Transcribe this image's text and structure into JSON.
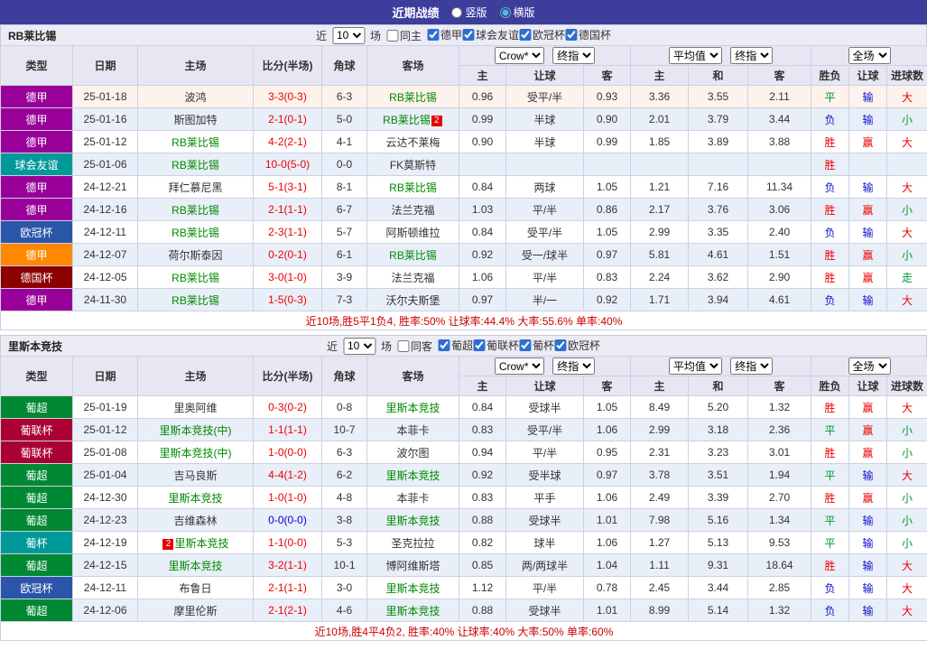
{
  "topbar": {
    "title": "近期战绩",
    "vertical": "竖版",
    "horizontal": "横版",
    "selected": "横版"
  },
  "result_colors": {
    "胜": "#ee0000",
    "平": "#009933",
    "负": "#1111cc",
    "赢": "#ee0000",
    "输": "#1111cc",
    "大": "#ee0000",
    "小": "#009933",
    "走": "#009933"
  },
  "sections": [
    {
      "team": "RB莱比锡",
      "filter": {
        "near": "近",
        "count": "10",
        "games": "场",
        "same": "同主",
        "same_checked": false,
        "leagues": [
          "德甲",
          "球会友谊",
          "欧冠杯",
          "德国杯"
        ]
      },
      "header": {
        "type": "类型",
        "date": "日期",
        "home": "主场",
        "score": "比分(半场)",
        "corner": "角球",
        "away": "客场",
        "dd1": "Crow*",
        "dd2": "终指",
        "dd3": "平均值",
        "dd4": "终指",
        "dd5": "全场",
        "sub": [
          "主",
          "让球",
          "客",
          "主",
          "和",
          "客",
          "胜负",
          "让球",
          "进球数"
        ]
      },
      "rows": [
        {
          "league": "德甲",
          "league_color": "#990099",
          "date": "25-01-18",
          "home": "波鸿",
          "home_green": false,
          "score": "3-3(0-3)",
          "score_color": "#ee0000",
          "corners": "6-3",
          "away": "RB莱比锡",
          "away_green": true,
          "asian_home": "0.96",
          "handicap": "受平/半",
          "asian_away": "0.93",
          "euro_home": "3.36",
          "euro_draw": "3.55",
          "euro_away": "2.11",
          "result": "平",
          "handicap_result": "输",
          "goals_result": "大",
          "highlight": true
        },
        {
          "league": "德甲",
          "league_color": "#990099",
          "date": "25-01-16",
          "home": "斯图加特",
          "home_green": false,
          "score": "2-1(0-1)",
          "score_color": "#ee0000",
          "corners": "5-0",
          "away": "RB莱比锡",
          "away_green": true,
          "away_card": "2",
          "away_card_pos": "after",
          "asian_home": "0.99",
          "handicap": "半球",
          "asian_away": "0.90",
          "euro_home": "2.01",
          "euro_draw": "3.79",
          "euro_away": "3.44",
          "result": "负",
          "handicap_result": "输",
          "goals_result": "小"
        },
        {
          "league": "德甲",
          "league_color": "#990099",
          "date": "25-01-12",
          "home": "RB莱比锡",
          "home_green": true,
          "score": "4-2(2-1)",
          "score_color": "#ee0000",
          "corners": "4-1",
          "away": "云达不莱梅",
          "away_green": false,
          "asian_home": "0.90",
          "handicap": "半球",
          "asian_away": "0.99",
          "euro_home": "1.85",
          "euro_draw": "3.89",
          "euro_away": "3.88",
          "result": "胜",
          "handicap_result": "赢",
          "goals_result": "大"
        },
        {
          "league": "球会友谊",
          "league_color": "#009999",
          "date": "25-01-06",
          "home": "RB莱比锡",
          "home_green": true,
          "score": "10-0(5-0)",
          "score_color": "#ee0000",
          "corners": "0-0",
          "away": "FK莫斯特",
          "away_green": false,
          "asian_home": "",
          "handicap": "",
          "asian_away": "",
          "euro_home": "",
          "euro_draw": "",
          "euro_away": "",
          "result": "胜",
          "handicap_result": "",
          "goals_result": ""
        },
        {
          "league": "德甲",
          "league_color": "#990099",
          "date": "24-12-21",
          "home": "拜仁慕尼黑",
          "home_green": false,
          "score": "5-1(3-1)",
          "score_color": "#ee0000",
          "corners": "8-1",
          "away": "RB莱比锡",
          "away_green": true,
          "asian_home": "0.84",
          "handicap": "两球",
          "asian_away": "1.05",
          "euro_home": "1.21",
          "euro_draw": "7.16",
          "euro_away": "11.34",
          "result": "负",
          "handicap_result": "输",
          "goals_result": "大"
        },
        {
          "league": "德甲",
          "league_color": "#990099",
          "date": "24-12-16",
          "home": "RB莱比锡",
          "home_green": true,
          "score": "2-1(1-1)",
          "score_color": "#ee0000",
          "corners": "6-7",
          "away": "法兰克福",
          "away_green": false,
          "asian_home": "1.03",
          "handicap": "平/半",
          "asian_away": "0.86",
          "euro_home": "2.17",
          "euro_draw": "3.76",
          "euro_away": "3.06",
          "result": "胜",
          "handicap_result": "赢",
          "goals_result": "小"
        },
        {
          "league": "欧冠杯",
          "league_color": "#2b55a8",
          "date": "24-12-11",
          "home": "RB莱比锡",
          "home_green": true,
          "score": "2-3(1-1)",
          "score_color": "#ee0000",
          "corners": "5-7",
          "away": "阿斯顿维拉",
          "away_green": false,
          "asian_home": "0.84",
          "handicap": "受平/半",
          "asian_away": "1.05",
          "euro_home": "2.99",
          "euro_draw": "3.35",
          "euro_away": "2.40",
          "result": "负",
          "handicap_result": "输",
          "goals_result": "大"
        },
        {
          "league": "德甲",
          "league_color": "#ff8800",
          "date": "24-12-07",
          "home": "荷尔斯泰因",
          "home_green": false,
          "score": "0-2(0-1)",
          "score_color": "#ee0000",
          "corners": "6-1",
          "away": "RB莱比锡",
          "away_green": true,
          "asian_home": "0.92",
          "handicap": "受一/球半",
          "asian_away": "0.97",
          "euro_home": "5.81",
          "euro_draw": "4.61",
          "euro_away": "1.51",
          "result": "胜",
          "handicap_result": "赢",
          "goals_result": "小"
        },
        {
          "league": "德国杯",
          "league_color": "#8b0000",
          "date": "24-12-05",
          "home": "RB莱比锡",
          "home_green": true,
          "score": "3-0(1-0)",
          "score_color": "#ee0000",
          "corners": "3-9",
          "away": "法兰克福",
          "away_green": false,
          "asian_home": "1.06",
          "handicap": "平/半",
          "asian_away": "0.83",
          "euro_home": "2.24",
          "euro_draw": "3.62",
          "euro_away": "2.90",
          "result": "胜",
          "handicap_result": "赢",
          "goals_result": "走"
        },
        {
          "league": "德甲",
          "league_color": "#990099",
          "date": "24-11-30",
          "home": "RB莱比锡",
          "home_green": true,
          "score": "1-5(0-3)",
          "score_color": "#ee0000",
          "corners": "7-3",
          "away": "沃尔夫斯堡",
          "away_green": false,
          "asian_home": "0.97",
          "handicap": "半/一",
          "asian_away": "0.92",
          "euro_home": "1.71",
          "euro_draw": "3.94",
          "euro_away": "4.61",
          "result": "负",
          "handicap_result": "输",
          "goals_result": "大"
        }
      ],
      "footer": "近10场,胜5平1负4, 胜率:50% 让球率:44.4% 大率:55.6% 单率:40%"
    },
    {
      "team": "里斯本竞技",
      "filter": {
        "near": "近",
        "count": "10",
        "games": "场",
        "same": "同客",
        "same_checked": false,
        "leagues": [
          "葡超",
          "葡联杯",
          "葡杯",
          "欧冠杯"
        ]
      },
      "header": {
        "type": "类型",
        "date": "日期",
        "home": "主场",
        "score": "比分(半场)",
        "corner": "角球",
        "away": "客场",
        "dd1": "Crow*",
        "dd2": "终指",
        "dd3": "平均值",
        "dd4": "终指",
        "dd5": "全场",
        "sub": [
          "主",
          "让球",
          "客",
          "主",
          "和",
          "客",
          "胜负",
          "让球",
          "进球数"
        ]
      },
      "rows": [
        {
          "league": "葡超",
          "league_color": "#008833",
          "date": "25-01-19",
          "home": "里奥阿维",
          "home_green": false,
          "score": "0-3(0-2)",
          "score_color": "#ee0000",
          "corners": "0-8",
          "away": "里斯本竞技",
          "away_green": true,
          "asian_home": "0.84",
          "handicap": "受球半",
          "asian_away": "1.05",
          "euro_home": "8.49",
          "euro_draw": "5.20",
          "euro_away": "1.32",
          "result": "胜",
          "handicap_result": "赢",
          "goals_result": "大"
        },
        {
          "league": "葡联杯",
          "league_color": "#aa0033",
          "date": "25-01-12",
          "home": "里斯本竞技(中)",
          "home_green": true,
          "score": "1-1(1-1)",
          "score_color": "#ee0000",
          "corners": "10-7",
          "away": "本菲卡",
          "away_green": false,
          "asian_home": "0.83",
          "handicap": "受平/半",
          "asian_away": "1.06",
          "euro_home": "2.99",
          "euro_draw": "3.18",
          "euro_away": "2.36",
          "result": "平",
          "handicap_result": "赢",
          "goals_result": "小"
        },
        {
          "league": "葡联杯",
          "league_color": "#aa0033",
          "date": "25-01-08",
          "home": "里斯本竞技(中)",
          "home_green": true,
          "score": "1-0(0-0)",
          "score_color": "#ee0000",
          "corners": "6-3",
          "away": "波尔图",
          "away_green": false,
          "asian_home": "0.94",
          "handicap": "平/半",
          "asian_away": "0.95",
          "euro_home": "2.31",
          "euro_draw": "3.23",
          "euro_away": "3.01",
          "result": "胜",
          "handicap_result": "赢",
          "goals_result": "小"
        },
        {
          "league": "葡超",
          "league_color": "#008833",
          "date": "25-01-04",
          "home": "吉马良斯",
          "home_green": false,
          "score": "4-4(1-2)",
          "score_color": "#ee0000",
          "corners": "6-2",
          "away": "里斯本竞技",
          "away_green": true,
          "asian_home": "0.92",
          "handicap": "受半球",
          "asian_away": "0.97",
          "euro_home": "3.78",
          "euro_draw": "3.51",
          "euro_away": "1.94",
          "result": "平",
          "handicap_result": "输",
          "goals_result": "大"
        },
        {
          "league": "葡超",
          "league_color": "#008833",
          "date": "24-12-30",
          "home": "里斯本竞技",
          "home_green": true,
          "score": "1-0(1-0)",
          "score_color": "#ee0000",
          "corners": "4-8",
          "away": "本菲卡",
          "away_green": false,
          "asian_home": "0.83",
          "handicap": "平手",
          "asian_away": "1.06",
          "euro_home": "2.49",
          "euro_draw": "3.39",
          "euro_away": "2.70",
          "result": "胜",
          "handicap_result": "赢",
          "goals_result": "小"
        },
        {
          "league": "葡超",
          "league_color": "#008833",
          "date": "24-12-23",
          "home": "吉维森林",
          "home_green": false,
          "score": "0-0(0-0)",
          "score_color": "#0000dd",
          "corners": "3-8",
          "away": "里斯本竞技",
          "away_green": true,
          "asian_home": "0.88",
          "handicap": "受球半",
          "asian_away": "1.01",
          "euro_home": "7.98",
          "euro_draw": "5.16",
          "euro_away": "1.34",
          "result": "平",
          "handicap_result": "输",
          "goals_result": "小"
        },
        {
          "league": "葡杯",
          "league_color": "#009999",
          "date": "24-12-19",
          "home": "里斯本竞技",
          "home_green": true,
          "home_card": "2",
          "home_card_pos": "before",
          "score": "1-1(0-0)",
          "score_color": "#ee0000",
          "corners": "5-3",
          "away": "圣克拉拉",
          "away_green": false,
          "asian_home": "0.82",
          "handicap": "球半",
          "asian_away": "1.06",
          "euro_home": "1.27",
          "euro_draw": "5.13",
          "euro_away": "9.53",
          "result": "平",
          "handicap_result": "输",
          "goals_result": "小"
        },
        {
          "league": "葡超",
          "league_color": "#008833",
          "date": "24-12-15",
          "home": "里斯本竞技",
          "home_green": true,
          "score": "3-2(1-1)",
          "score_color": "#ee0000",
          "corners": "10-1",
          "away": "博阿维斯塔",
          "away_green": false,
          "asian_home": "0.85",
          "handicap": "两/两球半",
          "asian_away": "1.04",
          "euro_home": "1.11",
          "euro_draw": "9.31",
          "euro_away": "18.64",
          "result": "胜",
          "handicap_result": "输",
          "goals_result": "大"
        },
        {
          "league": "欧冠杯",
          "league_color": "#2b55a8",
          "date": "24-12-11",
          "home": "布鲁日",
          "home_green": false,
          "score": "2-1(1-1)",
          "score_color": "#ee0000",
          "corners": "3-0",
          "away": "里斯本竞技",
          "away_green": true,
          "asian_home": "1.12",
          "handicap": "平/半",
          "asian_away": "0.78",
          "euro_home": "2.45",
          "euro_draw": "3.44",
          "euro_away": "2.85",
          "result": "负",
          "handicap_result": "输",
          "goals_result": "大"
        },
        {
          "league": "葡超",
          "league_color": "#008833",
          "date": "24-12-06",
          "home": "摩里伦斯",
          "home_green": false,
          "score": "2-1(2-1)",
          "score_color": "#ee0000",
          "corners": "4-6",
          "away": "里斯本竞技",
          "away_green": true,
          "asian_home": "0.88",
          "handicap": "受球半",
          "asian_away": "1.01",
          "euro_home": "8.99",
          "euro_draw": "5.14",
          "euro_away": "1.32",
          "result": "负",
          "handicap_result": "输",
          "goals_result": "大"
        }
      ],
      "footer": "近10场,胜4平4负2, 胜率:40% 让球率:40% 大率:50% 单率:60%"
    }
  ]
}
